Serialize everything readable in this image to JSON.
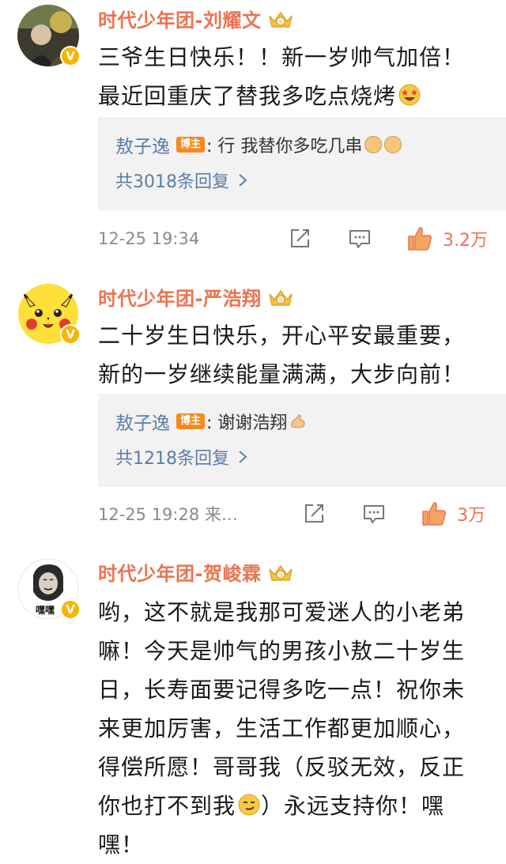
{
  "comments": [
    {
      "author": "时代少年团-刘耀文",
      "text_line1": "三爷生日快乐！！新一岁帅气加倍！",
      "text_line2": "最近回重庆了替我多吃点烧烤",
      "text_emoji": "star-struck-emoji",
      "reply": {
        "author": "敖子逸",
        "badge": "博主",
        "text": ": 行 我替你多吃几串",
        "emoji": "doge-emoji"
      },
      "more_replies": "共3018条回复",
      "timestamp": "12-25 19:34",
      "likes": "3.2万",
      "liked": true
    },
    {
      "author": "时代少年团-严浩翔",
      "text_line1": "二十岁生日快乐，开心平安最重要，",
      "text_line2": "新的一岁继续能量满满，大步向前！",
      "reply": {
        "author": "敖子逸",
        "badge": "博主",
        "text": ": 谢谢浩翔",
        "emoji": "muscle-emoji"
      },
      "more_replies": "共1218条回复",
      "timestamp": "12-25 19:28  来…",
      "likes": "3万",
      "liked": true
    },
    {
      "author": "时代少年团-贺峻霖",
      "avatar_text": "嘿嘿",
      "lines": [
        "哟，这不就是我那可爱迷人的小老弟",
        "嘛！今天是帅气的男孩小敖二十岁生",
        "日，长寿面要记得多吃一点！祝你未",
        "来更加厉害，生活工作都更加顺心，",
        "得偿所愿！哥哥我（反驳无效，反正",
        "你也打不到我",
        "嘿！"
      ],
      "line6_after_emoji": "）永远支持你！嘿",
      "line6_emoji": "smirk-emoji"
    }
  ],
  "colors": {
    "author": "#eb7350",
    "link": "#5b7ea6",
    "reply_bg": "#f2f2f2",
    "like": "#eb7350",
    "meta": "#8a8a8a"
  }
}
